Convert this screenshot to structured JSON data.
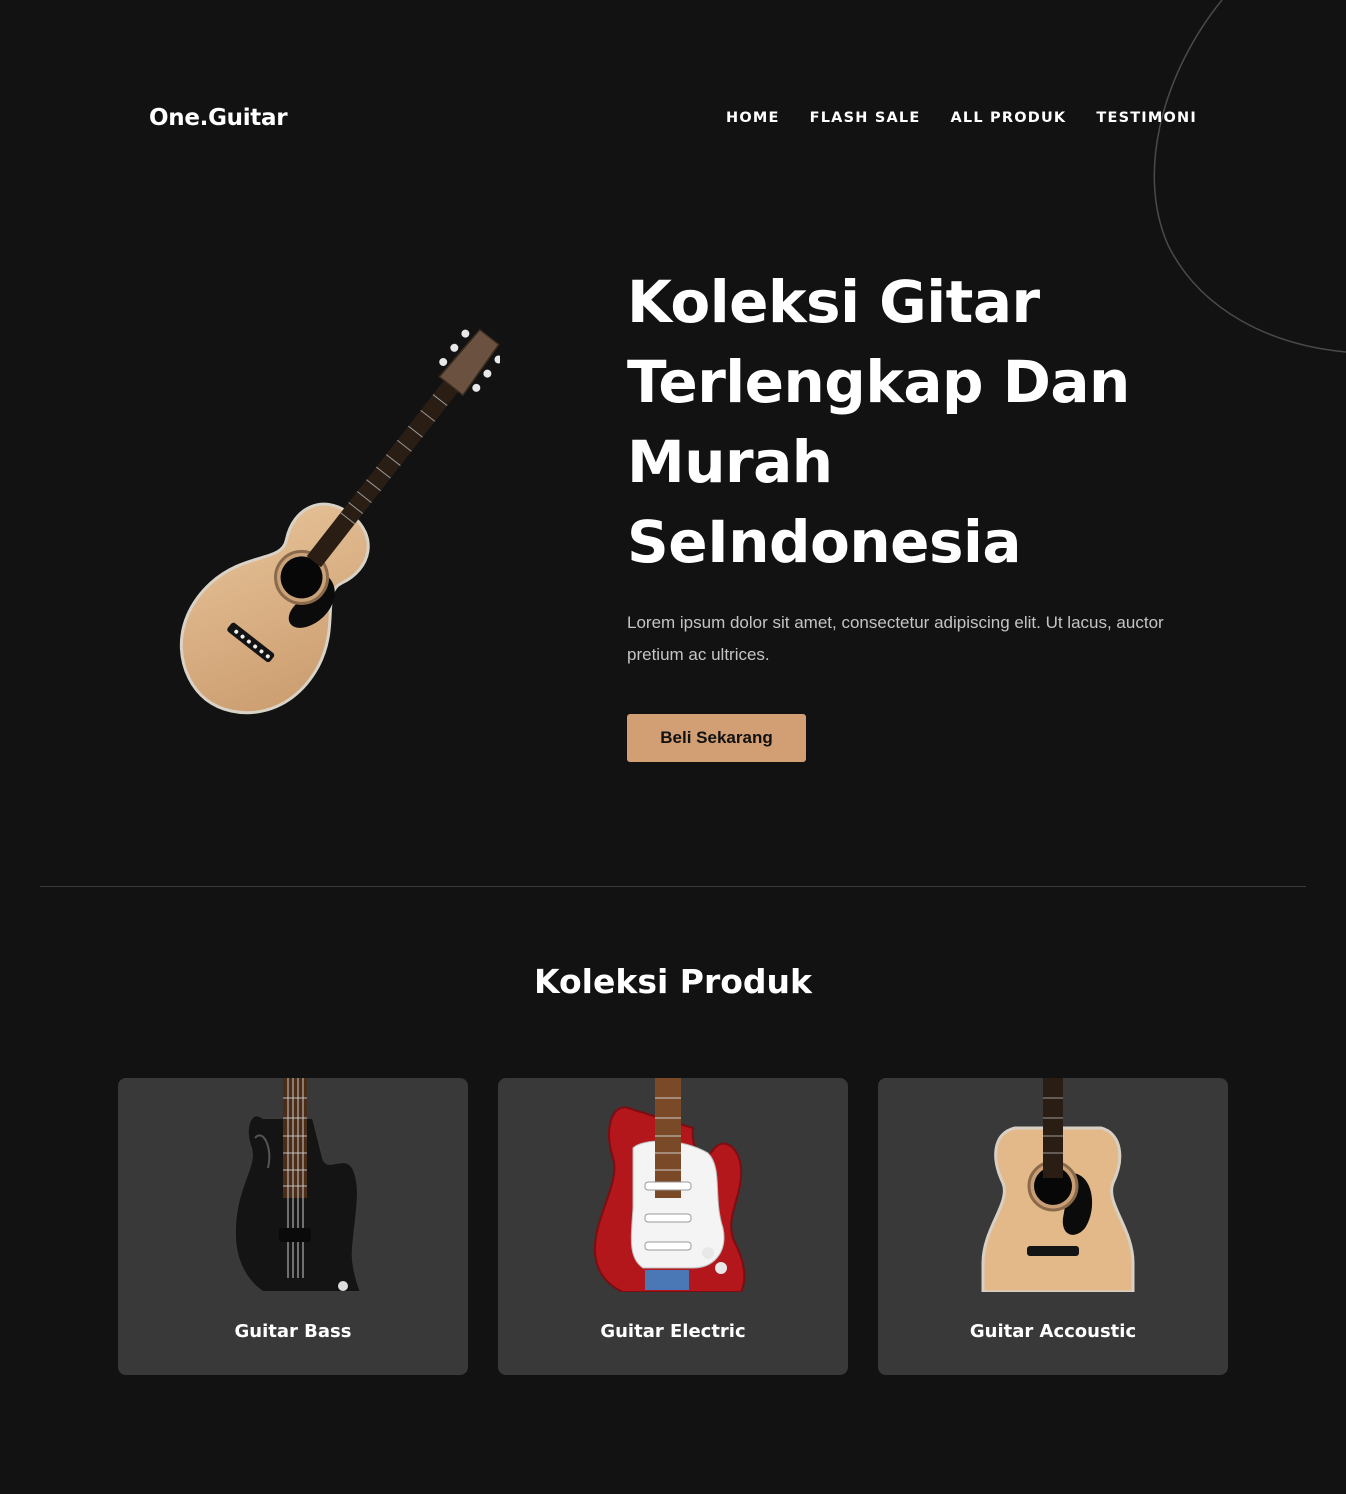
{
  "header": {
    "logo": "One.Guitar",
    "nav": [
      "HOME",
      "FLASH SALE",
      "ALL PRODUK",
      "TESTIMONI"
    ]
  },
  "hero": {
    "title_lines": [
      "Koleksi Gitar",
      "Terlengkap Dan",
      "Murah",
      "SeIndonesia"
    ],
    "description": "Lorem ipsum dolor sit amet, consectetur adipiscing elit. Ut lacus, auctor pretium ac ultrices.",
    "cta_label": "Beli Sekarang",
    "image": "acoustic-guitar"
  },
  "products": {
    "title": "Koleksi Produk",
    "items": [
      {
        "label": "Guitar Bass",
        "image": "bass-guitar"
      },
      {
        "label": "Guitar Electric",
        "image": "electric-guitar"
      },
      {
        "label": "Guitar Accoustic",
        "image": "acoustic-guitar"
      }
    ]
  },
  "colors": {
    "background": "#121212",
    "card": "#393939",
    "accent": "#d29e74",
    "text": "#ffffff",
    "muted": "#c4c4c4"
  }
}
